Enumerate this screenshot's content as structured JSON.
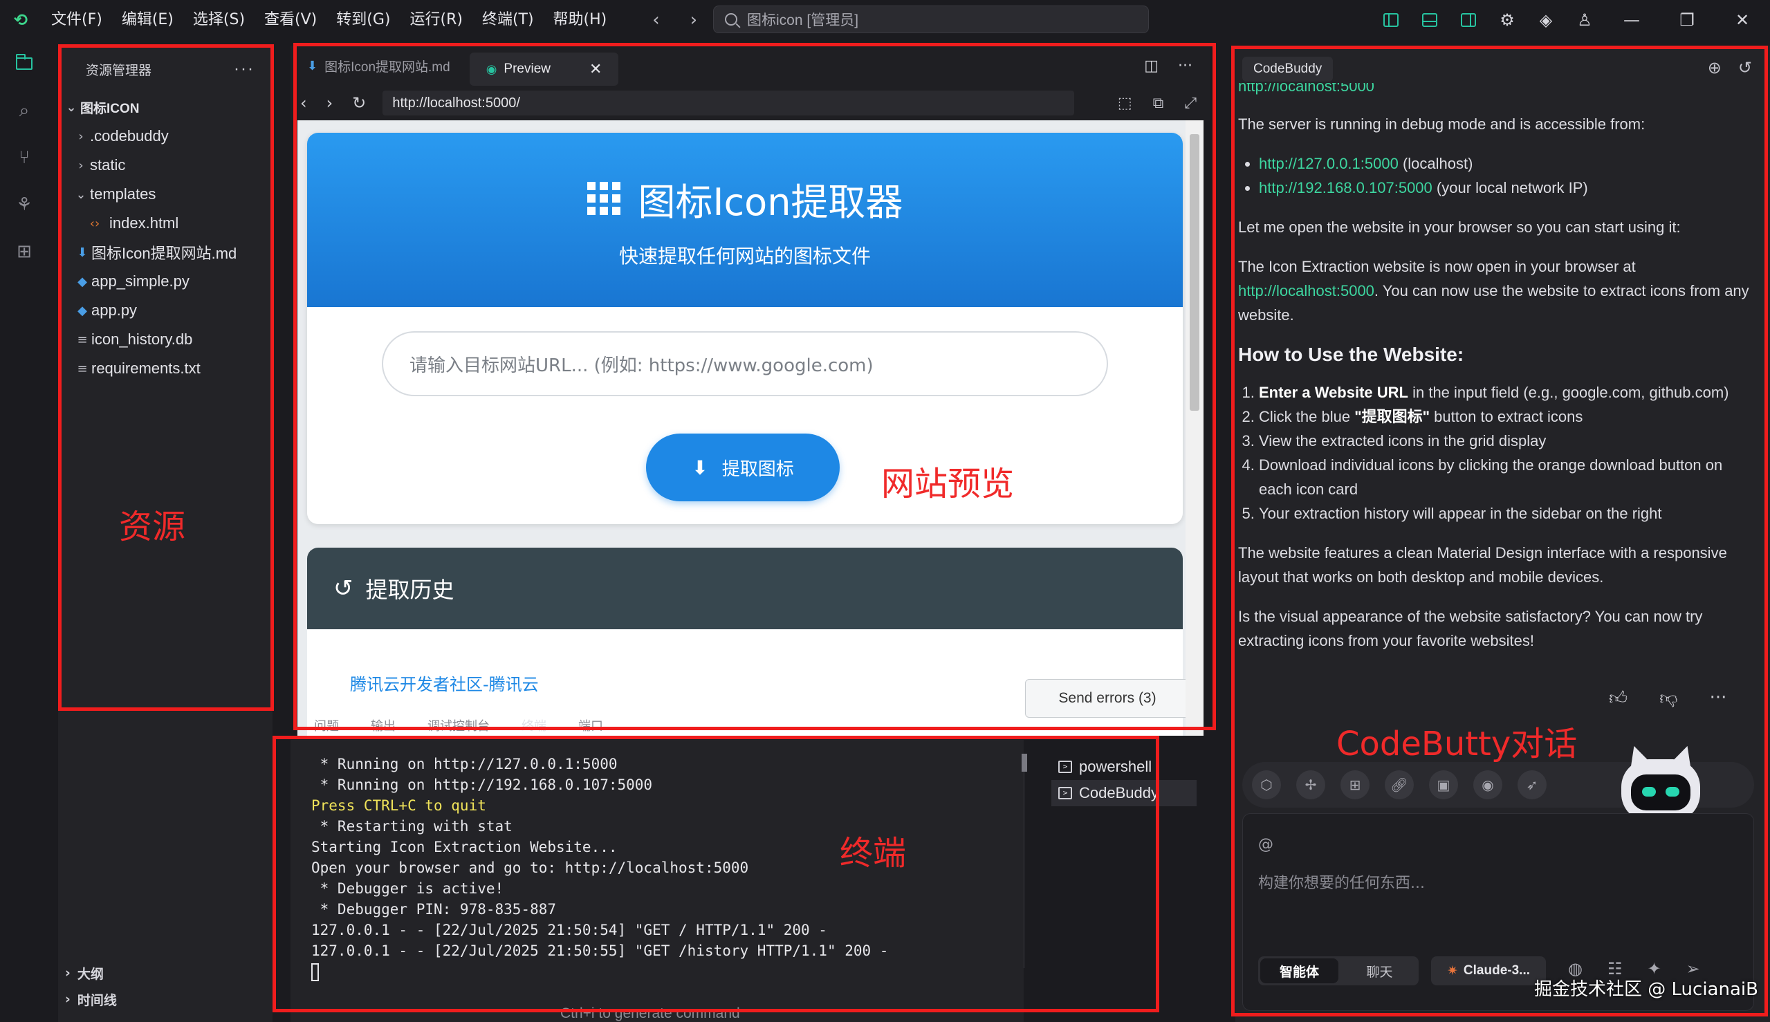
{
  "menubar": {
    "items": [
      "文件(F)",
      "编辑(E)",
      "选择(S)",
      "查看(V)",
      "转到(G)",
      "运行(R)",
      "终端(T)",
      "帮助(H)"
    ],
    "search_text": "图标icon [管理员]"
  },
  "explorer": {
    "title": "资源管理器",
    "root": "图标ICON",
    "items": [
      {
        "name": ".codebuddy",
        "type": "folder"
      },
      {
        "name": "static",
        "type": "folder"
      },
      {
        "name": "templates",
        "type": "folder-open"
      },
      {
        "name": "index.html",
        "type": "html"
      },
      {
        "name": "图标Icon提取网站.md",
        "type": "md"
      },
      {
        "name": "app_simple.py",
        "type": "py"
      },
      {
        "name": "app.py",
        "type": "py"
      },
      {
        "name": "icon_history.db",
        "type": "txt"
      },
      {
        "name": "requirements.txt",
        "type": "txt"
      }
    ],
    "outline": "大纲",
    "timeline": "时间线"
  },
  "editor": {
    "tab_md": "图标Icon提取网站.md",
    "tab_preview": "Preview",
    "url": "http://localhost:5000/"
  },
  "webpage": {
    "title": "图标Icon提取器",
    "subtitle": "快速提取任何网站的图标文件",
    "input_placeholder": "请输入目标网站URL... (例如: https://www.google.com)",
    "extract_button": "提取图标",
    "history_title": "提取历史",
    "history_link": "腾讯云开发者社区-腾讯云",
    "send_errors": "Send errors (3)"
  },
  "panel": {
    "tabs": [
      "问题",
      "输出",
      "调试控制台",
      "终端",
      "端口"
    ],
    "active_tab": "终端",
    "terminal_lines": [
      " * Running on http://127.0.0.1:5000",
      " * Running on http://192.168.0.107:5000",
      "Press CTRL+C to quit",
      " * Restarting with stat",
      "Starting Icon Extraction Website...",
      "Open your browser and go to: http://localhost:5000",
      " * Debugger is active!",
      " * Debugger PIN: 978-835-887",
      "127.0.0.1 - - [22/Jul/2025 21:50:54] \"GET / HTTP/1.1\" 200 -",
      "127.0.0.1 - - [22/Jul/2025 21:50:55] \"GET /history HTTP/1.1\" 200 -"
    ],
    "hint": "Ctrl+i to generate command",
    "terminal_list": [
      "powershell",
      "CodeBuddy"
    ]
  },
  "codebuddy": {
    "tab": "CodeBuddy",
    "top_cut": "http://localhost:5000",
    "p1": "The server is running in debug mode and is accessible from:",
    "links": [
      {
        "url": "http://127.0.0.1:5000",
        "note": " (localhost)"
      },
      {
        "url": "http://192.168.0.107:5000",
        "note": " (your local network IP)"
      }
    ],
    "p2": "Let me open the website in your browser so you can start using it:",
    "p3a": "The Icon Extraction website is now open in your browser at ",
    "p3link": "http://localhost:5000",
    "p3b": ". You can now use the website to extract icons from any website.",
    "h3": "How to Use the Website:",
    "steps": [
      {
        "bold": "Enter a Website URL",
        "rest": " in the input field (e.g., google.com, github.com)"
      },
      {
        "pre": "Click the blue ",
        "bold": "\"提取图标\"",
        "rest": " button to extract icons"
      },
      {
        "rest": "View the extracted icons in the grid display"
      },
      {
        "rest": "Download individual icons by clicking the orange download button on each icon card"
      },
      {
        "rest": "Your extraction history will appear in the sidebar on the right"
      }
    ],
    "p4": "The website features a clean Material Design interface with a responsive layout that works on both desktop and mobile devices.",
    "p5": "Is the visual appearance of the website satisfactory? You can now try extracting icons from your favorite websites!",
    "at": "@",
    "placeholder": "构建你想要的任何东西...",
    "mode_agent": "智能体",
    "mode_chat": "聊天",
    "model": "Claude-3..."
  },
  "annotations": {
    "resources": "资源",
    "preview": "网站预览",
    "terminal": "终端",
    "codebuddy": "CodeButty对话"
  },
  "watermark": "掘金技术社区 @ LucianaiB"
}
